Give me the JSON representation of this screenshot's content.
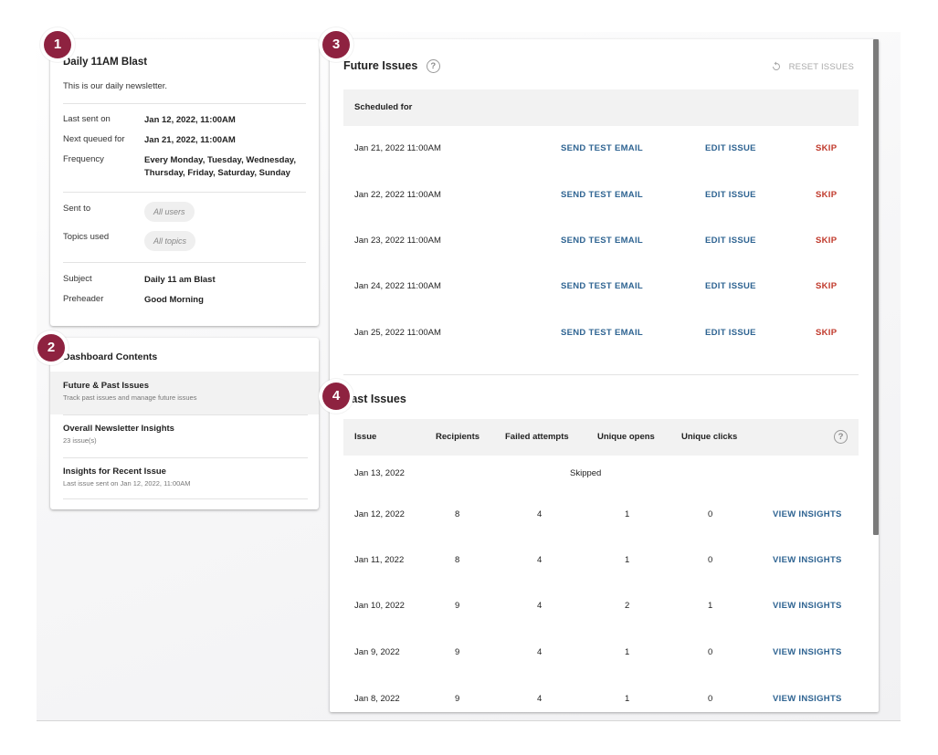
{
  "newsletter": {
    "title": "Daily 11AM Blast",
    "description": "This is our daily newsletter.",
    "last_sent_label": "Last sent on",
    "last_sent_value": "Jan 12, 2022, 11:00AM",
    "next_queued_label": "Next queued for",
    "next_queued_value": "Jan 21, 2022, 11:00AM",
    "frequency_label": "Frequency",
    "frequency_value": "Every Monday, Tuesday, Wednesday, Thursday, Friday, Saturday, Sunday",
    "sent_to_label": "Sent to",
    "sent_to_value": "All users",
    "topics_label": "Topics used",
    "topics_value": "All topics",
    "subject_label": "Subject",
    "subject_value": "Daily 11 am Blast",
    "preheader_label": "Preheader",
    "preheader_value": "Good Morning"
  },
  "dashboard": {
    "title": "Dashboard Contents",
    "items": [
      {
        "title": "Future & Past Issues",
        "subtitle": "Track past issues and manage future issues"
      },
      {
        "title": "Overall Newsletter Insights",
        "subtitle": "23 issue(s)"
      },
      {
        "title": "Insights for Recent Issue",
        "subtitle": "Last issue sent on Jan 12, 2022, 11:00AM"
      }
    ]
  },
  "future_issues": {
    "title": "Future Issues",
    "reset_label": "RESET ISSUES",
    "header": "Scheduled for",
    "send_test_label": "SEND TEST EMAIL",
    "edit_label": "EDIT ISSUE",
    "skip_label": "SKIP",
    "rows": [
      "Jan 21, 2022 11:00AM",
      "Jan 22, 2022 11:00AM",
      "Jan 23, 2022 11:00AM",
      "Jan 24, 2022 11:00AM",
      "Jan 25, 2022 11:00AM"
    ]
  },
  "past_issues": {
    "title": "Past Issues",
    "headers": [
      "Issue",
      "Recipients",
      "Failed attempts",
      "Unique opens",
      "Unique clicks"
    ],
    "skipped_label": "Skipped",
    "view_label": "VIEW INSIGHTS",
    "skipped_row": "Jan 13, 2022",
    "rows": [
      {
        "issue": "Jan 12, 2022",
        "recipients": "8",
        "failed": "4",
        "opens": "1",
        "clicks": "0"
      },
      {
        "issue": "Jan 11, 2022",
        "recipients": "8",
        "failed": "4",
        "opens": "1",
        "clicks": "0"
      },
      {
        "issue": "Jan 10, 2022",
        "recipients": "9",
        "failed": "4",
        "opens": "2",
        "clicks": "1"
      },
      {
        "issue": "Jan 9, 2022",
        "recipients": "9",
        "failed": "4",
        "opens": "1",
        "clicks": "0"
      },
      {
        "issue": "Jan 8, 2022",
        "recipients": "9",
        "failed": "4",
        "opens": "1",
        "clicks": "0"
      }
    ]
  },
  "markers": [
    "1",
    "2",
    "3",
    "4"
  ],
  "colors": {
    "marker": "#8e2240",
    "link": "#2f6492",
    "skip": "#c0392b"
  },
  "icons": {
    "help": "help-circle-icon",
    "reset": "refresh-icon"
  }
}
